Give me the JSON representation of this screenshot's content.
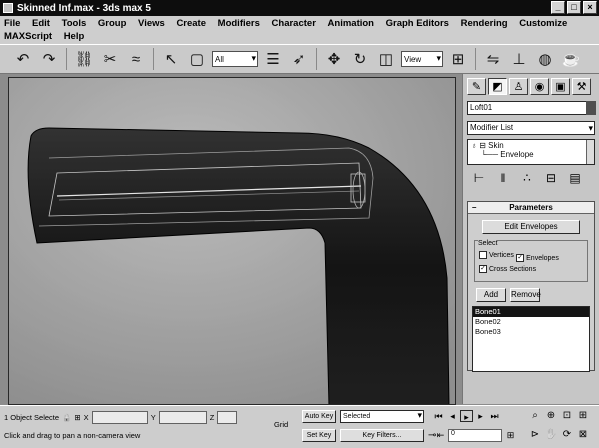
{
  "window": {
    "title": "Skinned Inf.max - 3ds max 5"
  },
  "menu": [
    "File",
    "Edit",
    "Tools",
    "Group",
    "Views",
    "Create",
    "Modifiers",
    "Character",
    "Animation",
    "Graph Editors",
    "Rendering",
    "Customize",
    "MAXScript",
    "Help"
  ],
  "toolbar": {
    "selection_filter": "All",
    "ref_coord": "View"
  },
  "panel": {
    "object_name": "Loft01",
    "modifier_list": "Modifier List",
    "stack": {
      "modifier": "Skin",
      "sub_object": "Envelope"
    },
    "rollout_title": "Parameters",
    "edit_envelopes": "Edit Envelopes",
    "select_group_label": "Select",
    "vertices": "Vertices",
    "envelopes": "Envelopes",
    "cross_sections": "Cross Sections",
    "add_label": "Add",
    "remove_label": "Remove",
    "bones": [
      "Bone01",
      "Bone02",
      "Bone03"
    ],
    "selected_bone": 0
  },
  "status": {
    "selection": "1 Object Selecte",
    "x_label": "X",
    "y_label": "Y",
    "z_label": "Z",
    "grid_label": "Grid",
    "prompt": "Click and drag to pan a non-camera view",
    "auto_key": "Auto Key",
    "set_key": "Set Key",
    "key_mode": "Selected",
    "key_filters": "Key Filters...",
    "frame": "0"
  }
}
